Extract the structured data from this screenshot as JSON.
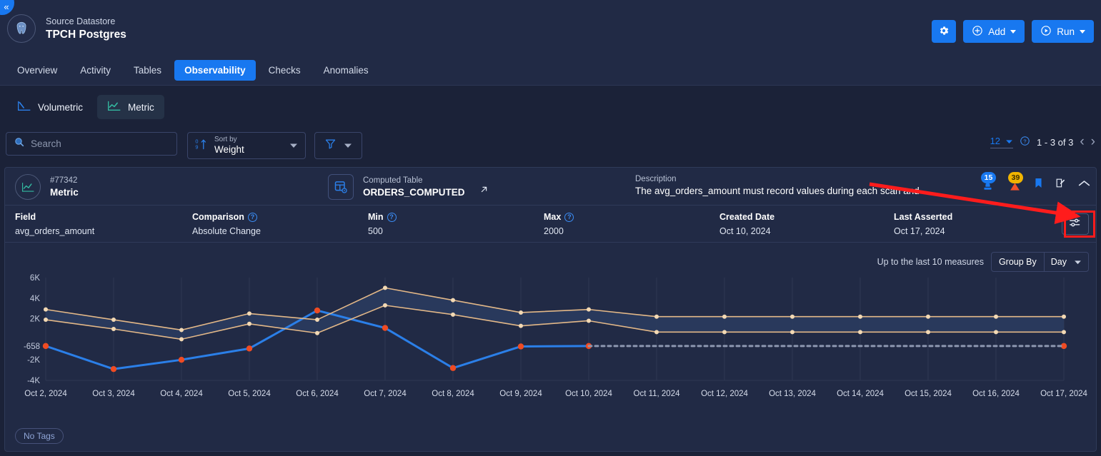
{
  "header": {
    "collapse_icon": "chevron-left-icon",
    "datastore_label": "Source Datastore",
    "datastore_name": "TPCH Postgres",
    "datastore_icon": "postgres-elephant-icon",
    "settings_icon": "gear-icon",
    "add_label": "Add",
    "add_icon": "plus-circle-icon",
    "run_label": "Run",
    "run_icon": "play-circle-icon",
    "tabs": [
      {
        "label": "Overview",
        "active": false
      },
      {
        "label": "Activity",
        "active": false
      },
      {
        "label": "Tables",
        "active": false
      },
      {
        "label": "Observability",
        "active": true
      },
      {
        "label": "Checks",
        "active": false
      },
      {
        "label": "Anomalies",
        "active": false
      }
    ]
  },
  "subtabs": [
    {
      "label": "Volumetric",
      "icon": "line-chart-down-icon",
      "active": false
    },
    {
      "label": "Metric",
      "icon": "line-chart-up-icon",
      "active": true
    }
  ],
  "filterbar": {
    "search_placeholder": "Search",
    "search_value": "",
    "search_icon": "search-icon",
    "sort_label": "Sort by",
    "sort_value": "Weight",
    "sort_icon": "sort-ascending-icon",
    "filter_icon": "funnel-icon",
    "page_size": "12",
    "help_icon": "question-circle-icon",
    "range": "1 - 3 of 3",
    "prev_icon": "chevron-left-icon",
    "next_icon": "chevron-right-icon"
  },
  "card": {
    "metric_id": "#77342",
    "metric_type": "Metric",
    "metric_icon": "metric-chart-icon",
    "table_label": "Computed Table",
    "table_name": "ORDERS_COMPUTED",
    "table_icon": "computed-table-icon",
    "external_link_icon": "external-link-icon",
    "description_label": "Description",
    "description_value": "The avg_orders_amount must record values during each scan and …",
    "badge_assertions": "15",
    "badge_anomalies": "39",
    "assertion_icon": "assertion-icon",
    "anomaly_icon": "warning-triangle-icon",
    "bookmark_icon": "bookmark-icon",
    "edit_icon": "edit-square-icon",
    "collapse_icon": "chevron-up-icon",
    "details": [
      {
        "label": "Field",
        "value": "avg_orders_amount",
        "help": false
      },
      {
        "label": "Comparison",
        "value": "Absolute Change",
        "help": true
      },
      {
        "label": "Min",
        "value": "500",
        "help": true
      },
      {
        "label": "Max",
        "value": "2000",
        "help": true
      },
      {
        "label": "Created Date",
        "value": "Oct 10, 2024",
        "help": false
      },
      {
        "label": "Last Asserted",
        "value": "Oct 17, 2024",
        "help": false
      }
    ],
    "sliders_icon": "sliders-settings-icon",
    "measures_text": "Up to the last 10 measures",
    "group_by_label": "Group By",
    "group_by_value": "Day",
    "tag_label": "No Tags"
  },
  "chart_data": {
    "type": "line",
    "title": "",
    "xlabel": "",
    "ylabel": "",
    "ylim": [
      -4000,
      6000
    ],
    "grid": true,
    "legend": "none",
    "y_ticks": [
      "6K",
      "4K",
      "2K",
      "-658",
      "-2K",
      "-4K"
    ],
    "y_tick_values": [
      6000,
      4000,
      2000,
      -658,
      -2000,
      -4000
    ],
    "categories": [
      "Oct 2, 2024",
      "Oct 3, 2024",
      "Oct 4, 2024",
      "Oct 5, 2024",
      "Oct 6, 2024",
      "Oct 7, 2024",
      "Oct 8, 2024",
      "Oct 9, 2024",
      "Oct 10, 2024",
      "Oct 11, 2024",
      "Oct 12, 2024",
      "Oct 13, 2024",
      "Oct 14, 2024",
      "Oct 15, 2024",
      "Oct 16, 2024",
      "Oct 17, 2024"
    ],
    "series": [
      {
        "name": "Measure",
        "color": "#2b7fe8",
        "point_color": "#ef4b23",
        "values": [
          -658,
          -2900,
          -2000,
          -900,
          2800,
          1100,
          -2800,
          -700,
          -658,
          null,
          null,
          null,
          null,
          null,
          null,
          -658
        ],
        "style": "solid"
      },
      {
        "name": "Upper Bound",
        "color": "#e3b888",
        "values": [
          2900,
          1900,
          900,
          2500,
          1900,
          5000,
          3800,
          2600,
          2900,
          2200,
          2200,
          2200,
          2200,
          2200,
          2200,
          2200
        ],
        "style": "solid"
      },
      {
        "name": "Lower Bound",
        "color": "#e3b888",
        "values": [
          1900,
          1000,
          0,
          1500,
          600,
          3300,
          2400,
          1300,
          1800,
          700,
          700,
          700,
          700,
          700,
          700,
          700
        ],
        "style": "solid"
      },
      {
        "name": "Projection",
        "color": "#8d97b0",
        "values": [
          null,
          null,
          null,
          null,
          null,
          null,
          null,
          null,
          -658,
          -658,
          -658,
          -658,
          -658,
          -658,
          -658,
          -658
        ],
        "style": "dashed"
      }
    ]
  },
  "annotation": {
    "arrow_color": "#ff1c1c",
    "highlight_target": "sliders-settings-icon"
  }
}
